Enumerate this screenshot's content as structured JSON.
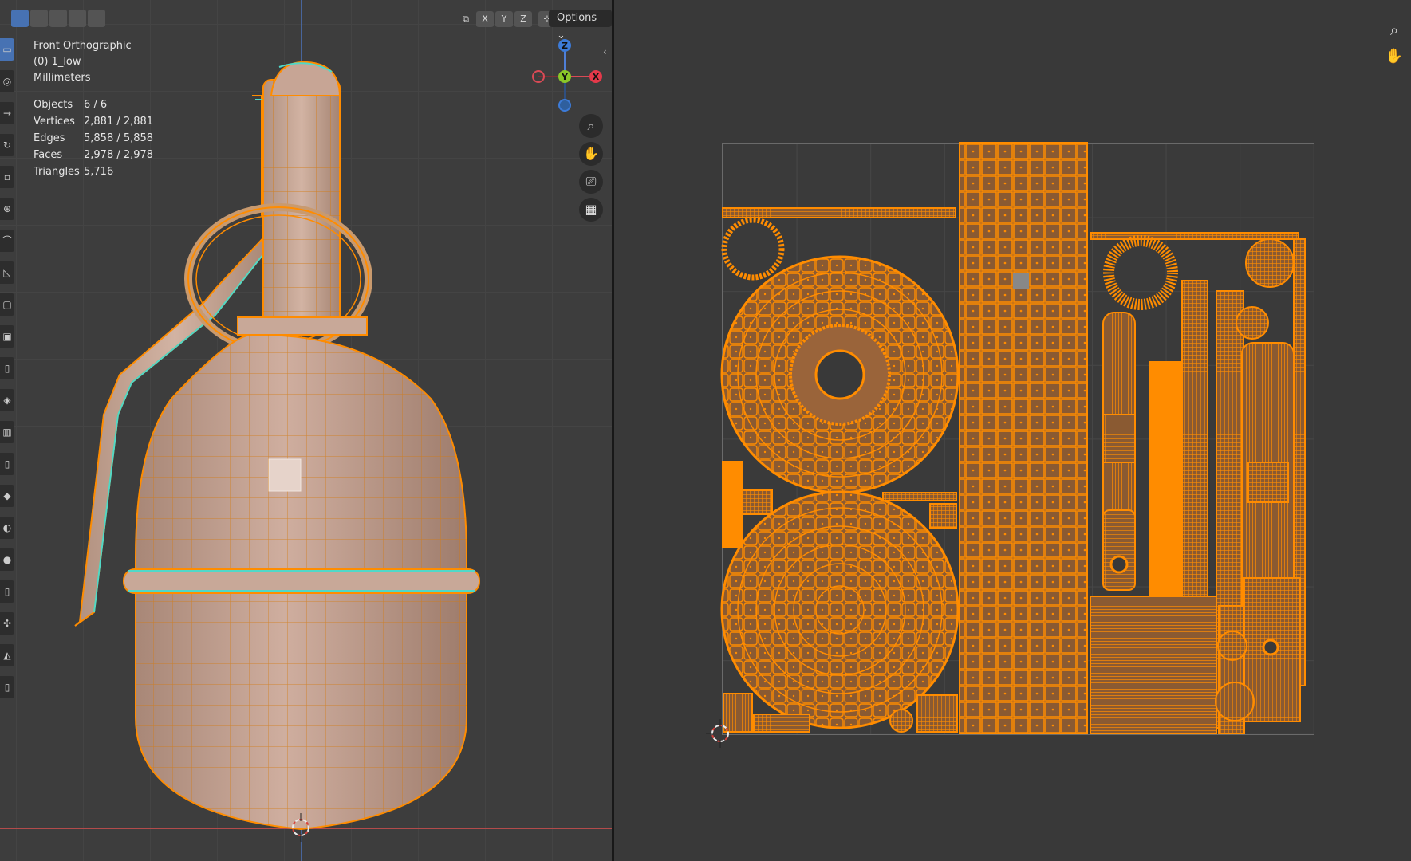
{
  "viewport3d": {
    "view_name": "Front Orthographic",
    "object_name": "(0) 1_low",
    "units": "Millimeters",
    "stats": [
      {
        "label": "Objects",
        "value": "6 / 6"
      },
      {
        "label": "Vertices",
        "value": "2,881 / 2,881"
      },
      {
        "label": "Edges",
        "value": "5,858 / 5,858"
      },
      {
        "label": "Faces",
        "value": "2,978 / 2,978"
      },
      {
        "label": "Triangles",
        "value": "5,716"
      }
    ],
    "header": {
      "axis_x": "X",
      "axis_y": "Y",
      "axis_z": "Z",
      "options_label": "Options"
    },
    "gizmo": {
      "x": "X",
      "y": "Y",
      "z": "Z"
    },
    "nav_icons": [
      "zoom-icon",
      "hand-pan-icon",
      "camera-icon",
      "grid-icon"
    ],
    "tools": [
      "select-box",
      "cursor",
      "move",
      "rotate",
      "scale",
      "transform",
      "annotate",
      "measure",
      "add-cube",
      "extrude",
      "inset",
      "bevel",
      "loop-cut",
      "knife",
      "poly-build",
      "spin",
      "smooth",
      "edge-slide",
      "shrink-fatten",
      "shear",
      "rip"
    ]
  },
  "uv_editor": {
    "nav_icons": [
      "zoom-icon",
      "hand-pan-icon"
    ]
  },
  "colors": {
    "selection_orange": "#ff8c00",
    "mesh_face": "#c9a08f",
    "seam_cyan": "#4fd8c8",
    "active_blue": "#4772b3"
  }
}
